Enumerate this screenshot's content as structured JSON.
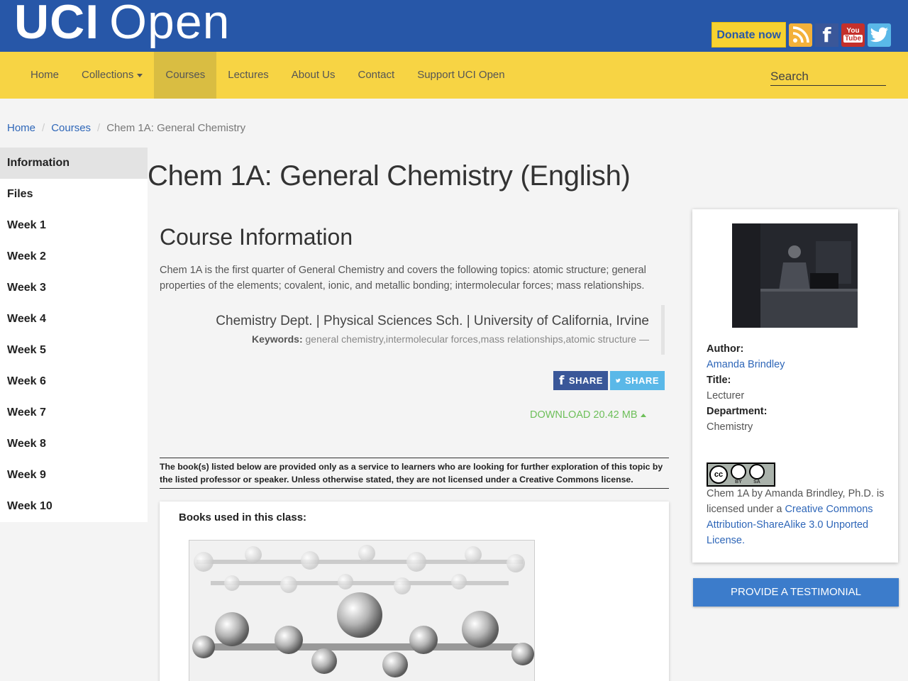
{
  "header": {
    "logo_bold": "UCI",
    "logo_light": "Open",
    "donate_label": "Donate now",
    "social": [
      "rss-icon",
      "facebook-icon",
      "youtube-icon",
      "twitter-icon"
    ],
    "youtube_top": "You",
    "youtube_bottom": "Tube"
  },
  "nav": {
    "items": [
      "Home",
      "Collections",
      "Courses",
      "Lectures",
      "About Us",
      "Contact",
      "Support UCI Open"
    ],
    "active": "Courses",
    "search_placeholder": "Search"
  },
  "breadcrumb": {
    "home": "Home",
    "courses": "Courses",
    "current": "Chem 1A: General Chemistry"
  },
  "sidebar": {
    "items": [
      "Information",
      "Files",
      "Week 1",
      "Week 2",
      "Week 3",
      "Week 4",
      "Week 5",
      "Week 6",
      "Week 7",
      "Week 8",
      "Week 9",
      "Week 10"
    ],
    "active": "Information"
  },
  "main": {
    "title": "Chem 1A: General Chemistry (English)",
    "section_title": "Course Information",
    "description": "Chem 1A is the first quarter of General Chemistry and covers the following topics: atomic structure; general properties of the elements; covalent, ionic, and metallic bonding; intermolecular forces; mass relationships.",
    "dept_line": "Chemistry Dept. | Physical Sciences Sch. | University of California, Irvine",
    "keywords_label": "Keywords:",
    "keywords": "general chemistry,intermolecular forces,mass relationships,atomic structure —",
    "share_fb": "SHARE",
    "share_tw": "SHARE",
    "download": "DOWNLOAD 20.42 MB",
    "disclaimer": "The book(s) listed below are provided only as a service to learners who are looking for further exploration of this topic by the listed professor or speaker. Unless otherwise stated, they are not licensed under a Creative Commons license.",
    "books_title": "Books used in this class:"
  },
  "author_card": {
    "author_label": "Author:",
    "author_name": "Amanda Brindley",
    "title_label": "Title:",
    "title_value": "Lecturer",
    "department_label": "Department:",
    "department_value": "Chemistry",
    "cc_mark": "cc",
    "cc_by": "BY",
    "cc_sa": "SA",
    "license_prefix": "Chem 1A by Amanda Brindley, Ph.D. is licensed under a ",
    "license_link": "Creative Commons Attribution-ShareAlike 3.0 Unported License."
  },
  "testimonial_label": "PROVIDE A TESTIMONIAL",
  "colors": {
    "header_blue": "#2757a8",
    "nav_yellow": "#f7d444",
    "link_blue": "#2e66b8",
    "download_green": "#6dbf59",
    "button_blue": "#3c7ccb"
  }
}
